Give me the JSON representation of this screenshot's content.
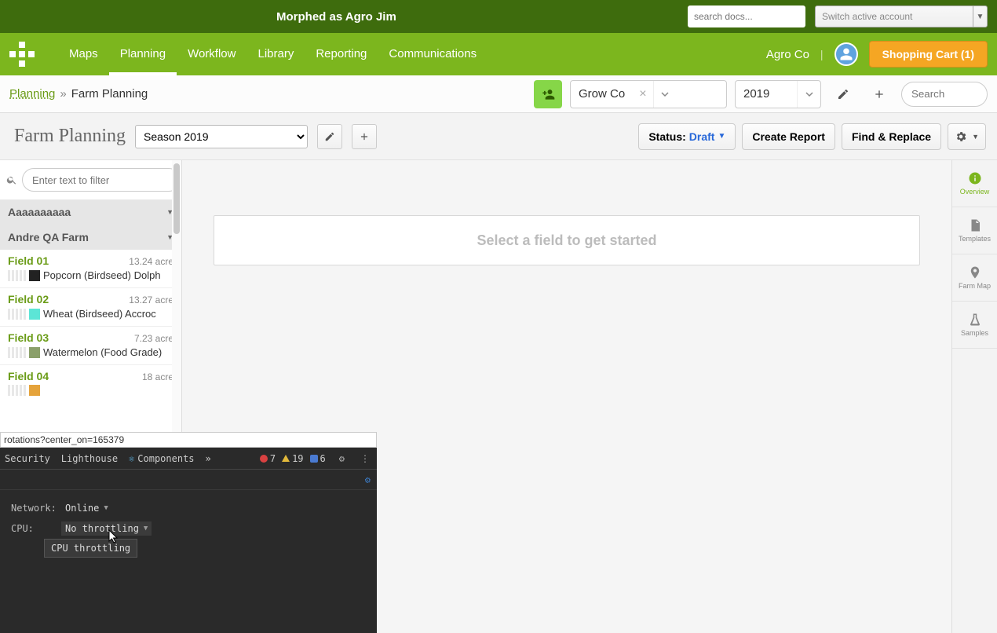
{
  "morph": {
    "title": "Morphed as Agro Jim",
    "search_placeholder": "search docs...",
    "switch_label": "Switch active account"
  },
  "nav": {
    "items": [
      "Maps",
      "Planning",
      "Workflow",
      "Library",
      "Reporting",
      "Communications"
    ],
    "active_index": 1,
    "account": "Agro Co",
    "cart_label": "Shopping Cart (1)"
  },
  "context": {
    "breadcrumb_root": "Planning",
    "breadcrumb_sep": "»",
    "breadcrumb_leaf": "Farm Planning",
    "grower_value": "Grow Co",
    "year_value": "2019",
    "search_placeholder": "Search"
  },
  "page_header": {
    "title": "Farm Planning",
    "season_options": [
      "Season 2019"
    ],
    "season_selected": "Season 2019",
    "status_prefix": "Status:",
    "status_value": "Draft",
    "create_report": "Create Report",
    "find_replace": "Find & Replace"
  },
  "sidebar": {
    "filter_placeholder": "Enter text to filter",
    "group_a": "Aaaaaaaaaa",
    "group_b": "Andre QA Farm",
    "fields": [
      {
        "name": "Field 01",
        "acre": "13.24 acre",
        "swatch": "#222222",
        "crop": "Popcorn (Birdseed) Dolph"
      },
      {
        "name": "Field 02",
        "acre": "13.27 acre",
        "swatch": "#5ce5d6",
        "crop": "Wheat (Birdseed) Accroc"
      },
      {
        "name": "Field 03",
        "acre": "7.23 acre",
        "swatch": "#8ba06a",
        "crop": "Watermelon (Food Grade)"
      },
      {
        "name": "Field 04",
        "acre": "18 acre",
        "swatch": "#e5a33b",
        "crop": ""
      }
    ]
  },
  "canvas": {
    "empty": "Select a field to get started"
  },
  "rail": {
    "items": [
      {
        "label": "Overview",
        "icon": "info"
      },
      {
        "label": "Templates",
        "icon": "doc"
      },
      {
        "label": "Farm Map",
        "icon": "pin"
      },
      {
        "label": "Samples",
        "icon": "flask"
      }
    ],
    "active_index": 0
  },
  "devtools": {
    "url_tail": "rotations?center_on=165379",
    "tabs": [
      "Security",
      "Lighthouse",
      "Components"
    ],
    "counts": {
      "errors": "7",
      "warnings": "19",
      "info": "6"
    },
    "network_label": "Network:",
    "network_value": "Online",
    "cpu_label": "CPU:",
    "cpu_value": "No throttling",
    "tooltip": "CPU throttling"
  }
}
